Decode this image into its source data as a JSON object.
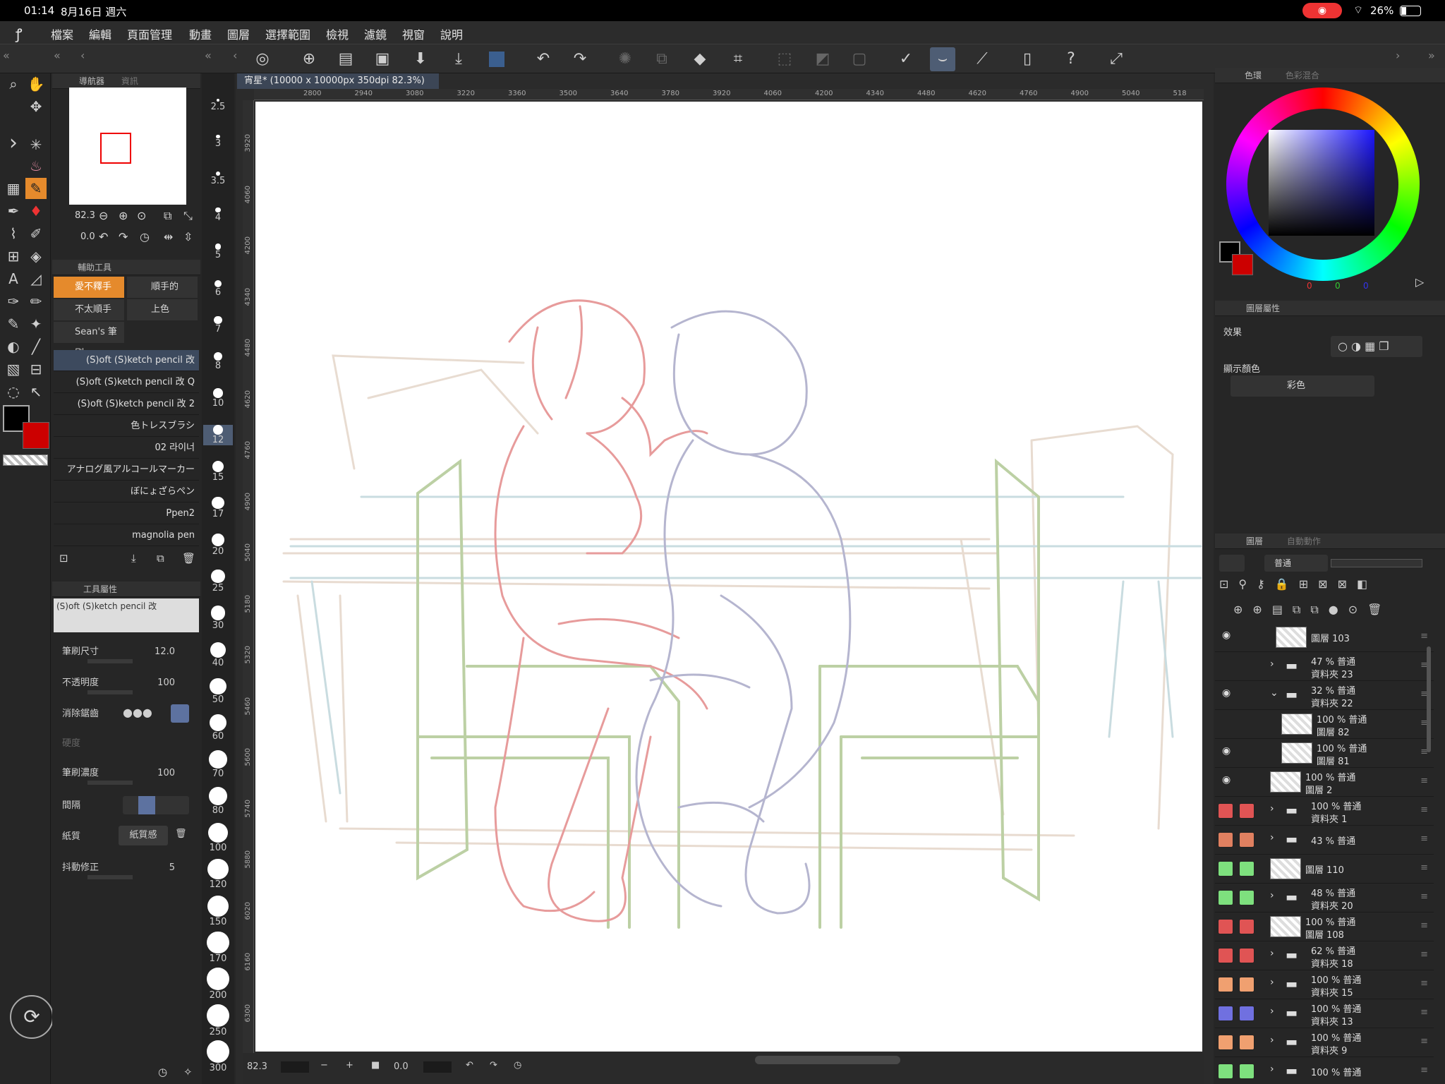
{
  "status": {
    "time": "01:14",
    "date": "8月16日 週六",
    "battery": "26%"
  },
  "menu": [
    "檔案",
    "編輯",
    "頁面管理",
    "動畫",
    "圖層",
    "選擇範圍",
    "檢視",
    "濾鏡",
    "視窗",
    "說明"
  ],
  "document": {
    "tab": "宵星* (10000 x 10000px 350dpi 82.3%)"
  },
  "ruler_h": [
    "2800",
    "2940",
    "3080",
    "3220",
    "3360",
    "3500",
    "3640",
    "3780",
    "3920",
    "4060",
    "4200",
    "4340",
    "4480",
    "4620",
    "4760",
    "4900",
    "5040",
    "518"
  ],
  "ruler_v": [
    "3920",
    "4060",
    "4200",
    "4340",
    "4480",
    "4620",
    "4760",
    "4900",
    "5040",
    "5180",
    "5320",
    "5460",
    "5600",
    "5740",
    "5880",
    "6020",
    "6160",
    "6300"
  ],
  "navigator": {
    "tab1": "導航器",
    "tab2": "資訊",
    "zoom": "82.3",
    "angle": "0.0"
  },
  "subtool": {
    "title": "輔助工具",
    "groups": [
      "愛不釋手",
      "順手的",
      "不太順手",
      "上色",
      "Sean's 筆刷"
    ],
    "brushes": [
      "(S)oft (S)ketch pencil 改",
      "(S)oft (S)ketch pencil 改 Q",
      "(S)oft (S)ketch pencil 改 2",
      "色トレスブラシ",
      "02 라이너",
      "アナログ風アルコールマーカー",
      "ぼにょざらペン",
      "Ppen2",
      "magnolia pen"
    ]
  },
  "toolprop": {
    "title": "工具屬性",
    "brush_name": "(S)oft (S)ketch pencil 改",
    "size_label": "筆刷尺寸",
    "size_value": "12.0",
    "opacity_label": "不透明度",
    "opacity_value": "100",
    "aa_label": "消除鋸齒",
    "hardness_label": "硬度",
    "density_label": "筆刷濃度",
    "density_value": "100",
    "spacing_label": "間隔",
    "paper_label": "紙質",
    "paper_button": "紙質感",
    "stabilize_label": "抖動修正",
    "stabilize_value": "5"
  },
  "brush_sizes": [
    "2.5",
    "3",
    "3.5",
    "4",
    "5",
    "6",
    "7",
    "8",
    "10",
    "12",
    "15",
    "17",
    "20",
    "25",
    "30",
    "40",
    "50",
    "60",
    "70",
    "80",
    "100",
    "120",
    "150",
    "170",
    "200",
    "250",
    "300"
  ],
  "color": {
    "tab1": "色環",
    "tab2": "色彩混合",
    "r": "0",
    "g": "0",
    "b": "0",
    "main": "#000000",
    "sub": "#cc0000"
  },
  "layerprop": {
    "tab": "圖層屬性",
    "effect_label": "效果",
    "display_label": "顯示顏色",
    "display_value": "彩色"
  },
  "layers": {
    "tab1": "圖層",
    "tab2": "自動動作",
    "blend": "普通",
    "rows": [
      {
        "name": "圖層 103",
        "pct": "",
        "type": "layer",
        "eye": true,
        "indent": 1,
        "tag": ""
      },
      {
        "name": "資料夾 23",
        "pct": "47 % 普通",
        "type": "folder",
        "eye": false,
        "indent": 1,
        "tag": ""
      },
      {
        "name": "資料夾 22",
        "pct": "32 % 普通",
        "type": "folder-open",
        "eye": true,
        "indent": 1,
        "tag": ""
      },
      {
        "name": "圖層 82",
        "pct": "100 % 普通",
        "type": "layer",
        "eye": false,
        "indent": 2,
        "tag": ""
      },
      {
        "name": "圖層 81",
        "pct": "100 % 普通",
        "type": "layer",
        "eye": true,
        "indent": 2,
        "tag": ""
      },
      {
        "name": "圖層 2",
        "pct": "100 % 普通",
        "type": "layer",
        "eye": true,
        "indent": 0,
        "tag": ""
      },
      {
        "name": "資料夾 1",
        "pct": "100 % 普通",
        "type": "folder",
        "eye": false,
        "indent": 1,
        "tag": "#e05454"
      },
      {
        "name": "43 % 普通",
        "pct": "",
        "type": "folder",
        "eye": false,
        "indent": 1,
        "tag": "#e08060"
      },
      {
        "name": "圖層 110",
        "pct": "",
        "type": "layer",
        "eye": false,
        "indent": 0,
        "tag": "#7ee07e"
      },
      {
        "name": "資料夾 20",
        "pct": "48 % 普通",
        "type": "folder",
        "eye": false,
        "indent": 1,
        "tag": "#7ee07e"
      },
      {
        "name": "圖層 108",
        "pct": "100 % 普通",
        "type": "layer",
        "eye": false,
        "indent": 0,
        "tag": "#e05454"
      },
      {
        "name": "資料夾 18",
        "pct": "62 % 普通",
        "type": "folder",
        "eye": false,
        "indent": 1,
        "tag": "#e05454"
      },
      {
        "name": "資料夾 15",
        "pct": "100 % 普通",
        "type": "folder",
        "eye": false,
        "indent": 1,
        "tag": "#f0a070"
      },
      {
        "name": "資料夾 13",
        "pct": "100 % 普通",
        "type": "folder",
        "eye": false,
        "indent": 1,
        "tag": "#7070e0"
      },
      {
        "name": "資料夾 9",
        "pct": "100 % 普通",
        "type": "folder",
        "eye": false,
        "indent": 1,
        "tag": "#f0a070"
      },
      {
        "name": "100 % 普通",
        "pct": "",
        "type": "folder",
        "eye": false,
        "indent": 1,
        "tag": "#7ee07e"
      }
    ]
  },
  "bottom": {
    "zoom": "82.3",
    "angle": "0.0"
  }
}
